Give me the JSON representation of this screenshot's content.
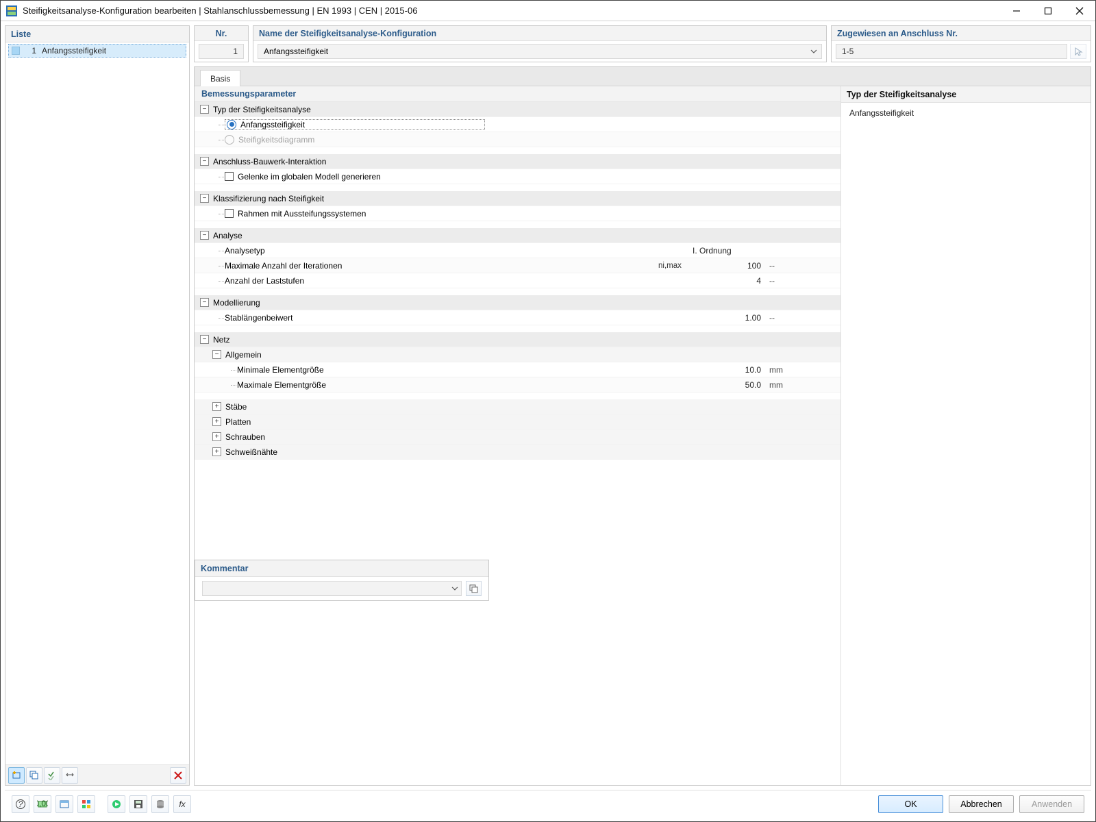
{
  "window": {
    "title": "Steifigkeitsanalyse-Konfiguration bearbeiten | Stahlanschlussbemessung | EN 1993 | CEN | 2015-06"
  },
  "list": {
    "header": "Liste",
    "items": [
      {
        "num": "1",
        "label": "Anfangssteifigkeit"
      }
    ]
  },
  "header": {
    "nr_label": "Nr.",
    "nr_value": "1",
    "name_label": "Name der Steifigkeitsanalyse-Konfiguration",
    "name_value": "Anfangssteifigkeit",
    "assign_label": "Zugewiesen an Anschluss Nr.",
    "assign_value": "1-5"
  },
  "tabs": {
    "basis": "Basis"
  },
  "params": {
    "title": "Bemessungsparameter",
    "g_type": "Typ der Steifigkeitsanalyse",
    "r_initial": "Anfangssteifigkeit",
    "r_diagram": "Steifigkeitsdiagramm",
    "g_interaction": "Anschluss-Bauwerk-Interaktion",
    "c_hinges": "Gelenke im globalen Modell generieren",
    "g_classify": "Klassifizierung nach Steifigkeit",
    "c_braced": "Rahmen mit Aussteifungssystemen",
    "g_analysis": "Analyse",
    "p_atype": "Analysetyp",
    "v_atype": "I. Ordnung",
    "p_iter": "Maximale Anzahl der Iterationen",
    "s_iter": "ni,max",
    "v_iter": "100",
    "u_iter": "--",
    "p_steps": "Anzahl der Laststufen",
    "v_steps": "4",
    "u_steps": "--",
    "g_model": "Modellierung",
    "p_stab": "Stablängenbeiwert",
    "v_stab": "1.00",
    "u_stab": "--",
    "g_mesh": "Netz",
    "g_general": "Allgemein",
    "p_min": "Minimale Elementgröße",
    "v_min": "10.0",
    "u_min": "mm",
    "p_max": "Maximale Elementgröße",
    "v_max": "50.0",
    "u_max": "mm",
    "g_members": "Stäbe",
    "g_plates": "Platten",
    "g_bolts": "Schrauben",
    "g_welds": "Schweißnähte"
  },
  "side": {
    "title": "Typ der Steifigkeitsanalyse",
    "value": "Anfangssteifigkeit"
  },
  "comment": {
    "label": "Kommentar"
  },
  "footer": {
    "ok": "OK",
    "cancel": "Abbrechen",
    "apply": "Anwenden"
  }
}
